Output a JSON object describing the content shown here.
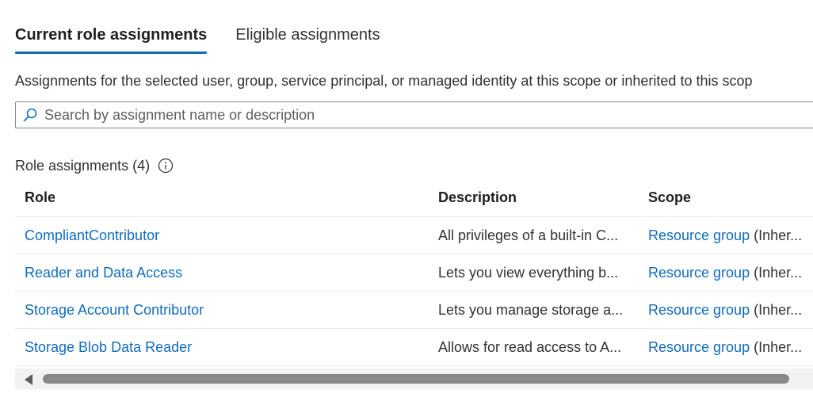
{
  "tabs": [
    {
      "label": "Current role assignments",
      "active": true
    },
    {
      "label": "Eligible assignments",
      "active": false
    }
  ],
  "description": "Assignments for the selected user, group, service principal, or managed identity at this scope or inherited to this scop",
  "search": {
    "placeholder": "Search by assignment name or description",
    "value": ""
  },
  "role_assignments": {
    "label": "Role assignments (4)"
  },
  "table": {
    "columns": [
      "Role",
      "Description",
      "Scope"
    ],
    "rows": [
      {
        "role": "CompliantContributor",
        "description": "All privileges of a built-in C...",
        "scope_link": "Resource group",
        "scope_suffix": " (Inher..."
      },
      {
        "role": "Reader and Data Access",
        "description": "Lets you view everything b...",
        "scope_link": "Resource group",
        "scope_suffix": " (Inher..."
      },
      {
        "role": "Storage Account Contributor",
        "description": "Lets you manage storage a...",
        "scope_link": "Resource group",
        "scope_suffix": " (Inher..."
      },
      {
        "role": "Storage Blob Data Reader",
        "description": "Allows for read access to A...",
        "scope_link": "Resource group",
        "scope_suffix": " (Inher..."
      }
    ]
  },
  "icons": {
    "search": "search-icon",
    "info": "info-icon",
    "scroll_left": "chevron-left-icon"
  },
  "colors": {
    "accent": "#0f6cbd",
    "text": "#323130",
    "border": "#8a8886"
  }
}
